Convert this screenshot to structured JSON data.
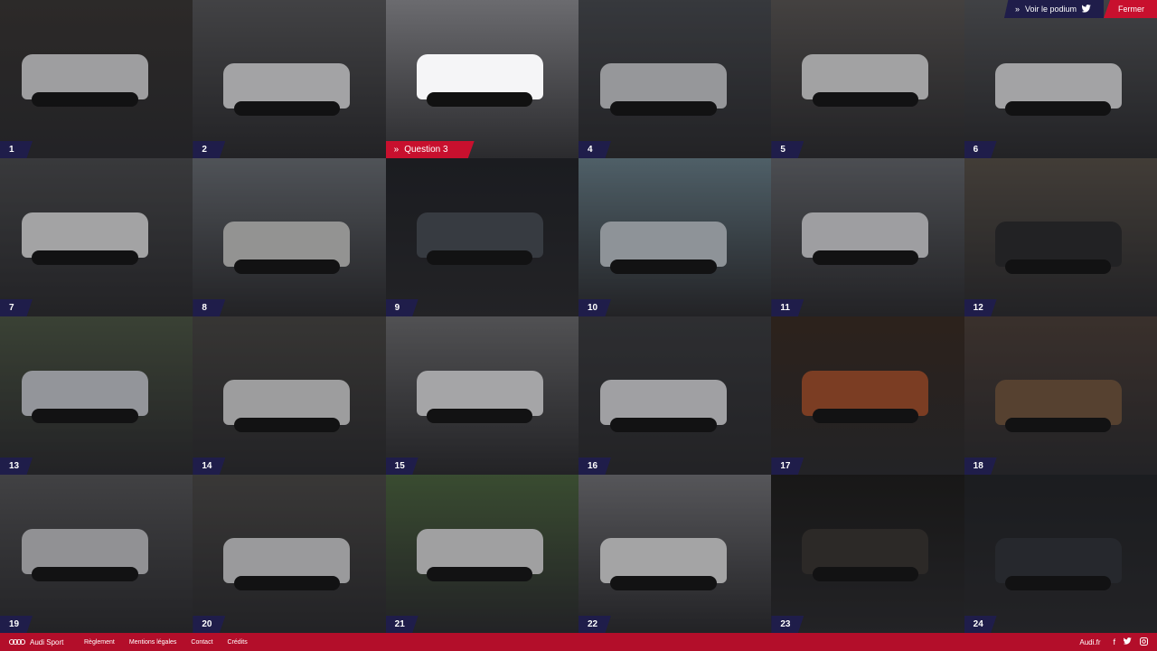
{
  "topbar": {
    "podium_label": "Voir le podium",
    "podium_arrow": "»",
    "close_label": "Fermer"
  },
  "active_tile_label": "Question 3",
  "tiles": [
    {
      "n": "1",
      "bg": "#3a3633",
      "car": "#e9e9ea"
    },
    {
      "n": "2",
      "bg": "#5b5b5d",
      "car": "#f0f0f1"
    },
    {
      "n": "3",
      "bg": "#6b6b6f",
      "car": "#f5f5f7"
    },
    {
      "n": "4",
      "bg": "#4a4d52",
      "car": "#dcdde0"
    },
    {
      "n": "5",
      "bg": "#5e5a57",
      "car": "#efefef"
    },
    {
      "n": "6",
      "bg": "#585a5d",
      "car": "#f0f0f1"
    },
    {
      "n": "7",
      "bg": "#4d4e50",
      "car": "#f0f0f0"
    },
    {
      "n": "8",
      "bg": "#70757b",
      "car": "#d8d7d4"
    },
    {
      "n": "9",
      "bg": "#1f2126",
      "car": "#4b5058"
    },
    {
      "n": "10",
      "bg": "#6f8893",
      "car": "#cfd8dd"
    },
    {
      "n": "11",
      "bg": "#6a6d72",
      "car": "#e8e9ec"
    },
    {
      "n": "12",
      "bg": "#5b5349",
      "car": "#2a2a2c"
    },
    {
      "n": "13",
      "bg": "#4f5a45",
      "car": "#d7dbe0"
    },
    {
      "n": "14",
      "bg": "#4a4844",
      "car": "#e6e6e6"
    },
    {
      "n": "15",
      "bg": "#727274",
      "car": "#f3f3f4"
    },
    {
      "n": "16",
      "bg": "#3c3d40",
      "car": "#ececef"
    },
    {
      "n": "17",
      "bg": "#3a2a1f",
      "car": "#b2542a"
    },
    {
      "n": "18",
      "bg": "#4f4038",
      "car": "#7a5a3e"
    },
    {
      "n": "19",
      "bg": "#5a5a5c",
      "car": "#d5d5d8"
    },
    {
      "n": "20",
      "bg": "#4e4c49",
      "car": "#e2e2e3"
    },
    {
      "n": "21",
      "bg": "#4e6a3f",
      "car": "#ececec"
    },
    {
      "n": "22",
      "bg": "#7a7a7e",
      "car": "#f2f2f2"
    },
    {
      "n": "23",
      "bg": "#1b1a18",
      "car": "#3a3530"
    },
    {
      "n": "24",
      "bg": "#202225",
      "car": "#30343a"
    }
  ],
  "footer": {
    "brand": "Audi Sport",
    "links": [
      "Règlement",
      "Mentions légales",
      "Contact",
      "Crédits"
    ],
    "site": "Audi.fr",
    "social": [
      "f",
      "t",
      "ig"
    ]
  },
  "colors": {
    "accent": "#c8102e",
    "badge": "#1f1d4a",
    "footer": "#b30e2a"
  }
}
